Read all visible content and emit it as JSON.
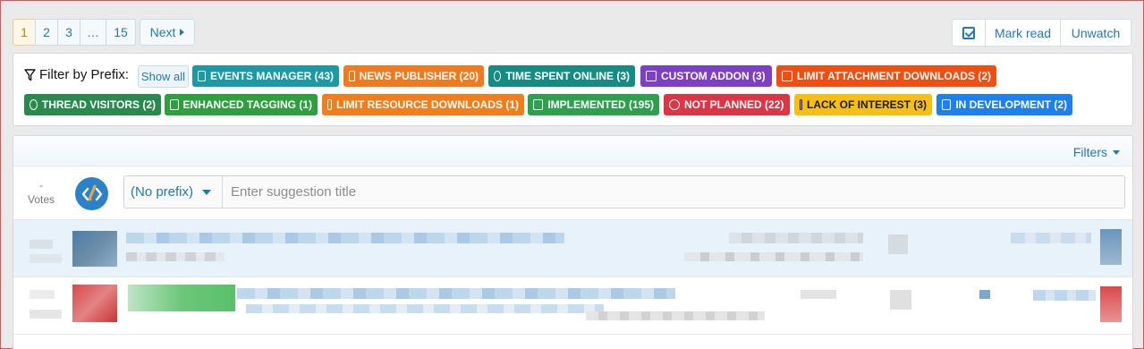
{
  "pagination": {
    "pages": [
      "1",
      "2",
      "3",
      "…",
      "15"
    ],
    "current": "1",
    "next_label": "Next"
  },
  "actions": {
    "mark_read": "Mark read",
    "unwatch": "Unwatch"
  },
  "filter": {
    "label": "Filter by Prefix:",
    "show_all": "Show all",
    "tags": [
      {
        "label": "EVENTS MANAGER (43)",
        "color": "#1b9aa6",
        "icon": "calendar-icon"
      },
      {
        "label": "NEWS PUBLISHER (20)",
        "color": "#f17a1e",
        "icon": "newspaper-icon"
      },
      {
        "label": "TIME SPENT ONLINE (3)",
        "color": "#168b83",
        "icon": "clock-icon"
      },
      {
        "label": "CUSTOM ADDON (3)",
        "color": "#7d3fc6",
        "icon": "wrench-icon"
      },
      {
        "label": "LIMIT ATTACHMENT DOWNLOADS (2)",
        "color": "#f24e11",
        "icon": "paperclip-icon"
      },
      {
        "label": "THREAD VISITORS (2)",
        "color": "#2a8a4e",
        "icon": "users-icon"
      },
      {
        "label": "ENHANCED TAGGING (1)",
        "color": "#2f9e3e",
        "icon": "tags-icon"
      },
      {
        "label": "LIMIT RESOURCE DOWNLOADS (1)",
        "color": "#f27d1b",
        "icon": "arrow-down-icon"
      },
      {
        "label": "IMPLEMENTED (195)",
        "color": "#2e9e4f",
        "icon": "inbox-icon"
      },
      {
        "label": "NOT PLANNED (22)",
        "color": "#dc3545",
        "icon": "x-circle-icon"
      },
      {
        "label": "LACK OF INTEREST (3)",
        "color": "#f5c013",
        "icon": "thumbs-down-icon"
      },
      {
        "label": "IN DEVELOPMENT (2)",
        "color": "#1e7ff0",
        "icon": "code-icon"
      }
    ]
  },
  "list": {
    "filters_label": "Filters",
    "votes_dash": "-",
    "votes_label": "Votes",
    "prefix_select": "(No prefix)",
    "title_placeholder": "Enter suggestion title"
  }
}
